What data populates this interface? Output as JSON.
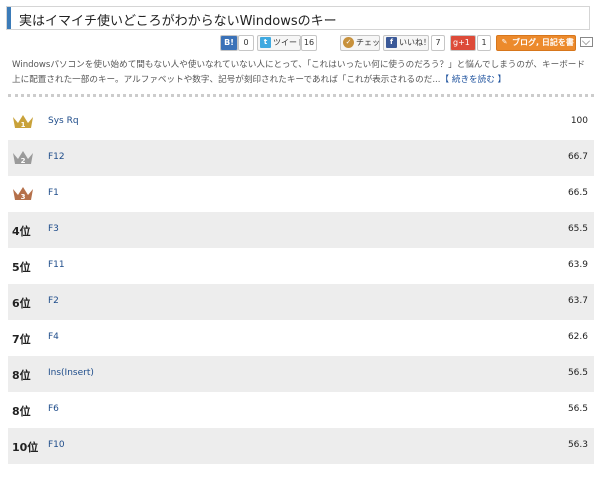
{
  "title": "実はイマイチ使いどころがわからないWindowsのキー",
  "share": {
    "bookmark_count": "0",
    "tweet_label": "ツイート",
    "tweet_count": "16",
    "check_label": "チェック",
    "like_label": "いいね！",
    "like_count": "7",
    "gplus_label": "+1",
    "gplus_count": "1",
    "blog_label": "ブログ, 日記を書く"
  },
  "description": {
    "text": "Windowsパソコンを使い始めて間もない人や使いなれていない人にとって、「これはいったい何に使うのだろう？」と悩んでしまうのが、キーボード上に配置された一部のキー。アルファベットや数字、記号が刻印されたキーであれば「これが表示されるのだ...",
    "more": "【 続きを読む 】"
  },
  "colors": {
    "gold": "#c9a23a",
    "silver": "#9a9a9a",
    "bronze": "#b5704a",
    "link": "#1e4c8a",
    "accent": "#3b7bb8"
  },
  "ranking": [
    {
      "rank": "1",
      "medal": "gold",
      "name": "Sys Rq",
      "score": "100"
    },
    {
      "rank": "2",
      "medal": "silver",
      "name": "F12",
      "score": "66.7"
    },
    {
      "rank": "3",
      "medal": "bronze",
      "name": "F1",
      "score": "66.5"
    },
    {
      "rank": "4位",
      "name": "F3",
      "score": "65.5"
    },
    {
      "rank": "5位",
      "name": "F11",
      "score": "63.9"
    },
    {
      "rank": "6位",
      "name": "F2",
      "score": "63.7"
    },
    {
      "rank": "7位",
      "name": "F4",
      "score": "62.6"
    },
    {
      "rank": "8位",
      "name": "Ins(Insert)",
      "score": "56.5"
    },
    {
      "rank": "8位",
      "name": "F6",
      "score": "56.5"
    },
    {
      "rank": "10位",
      "name": "F10",
      "score": "56.3"
    }
  ]
}
